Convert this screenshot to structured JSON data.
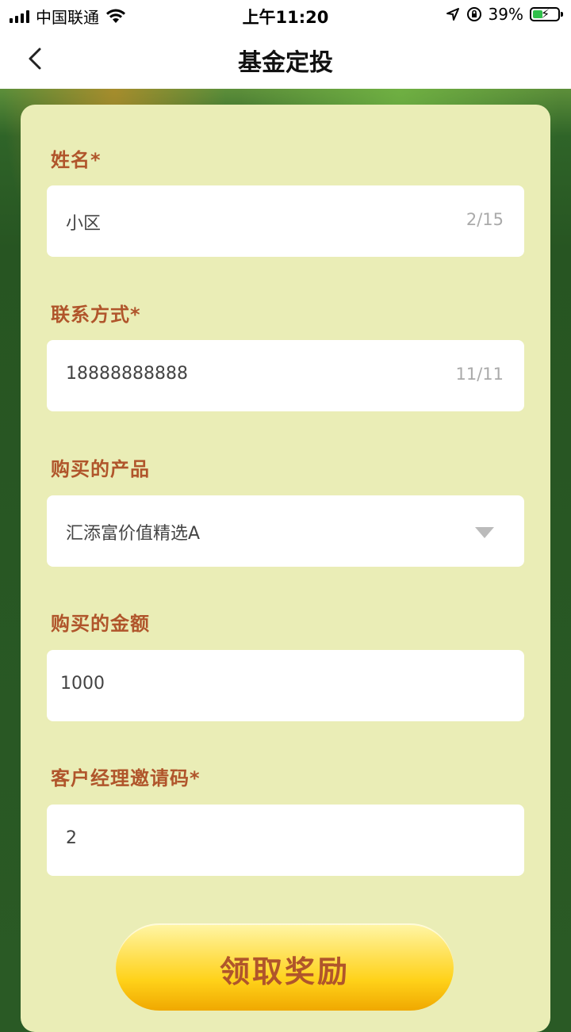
{
  "status_bar": {
    "carrier": "中国联通",
    "time": "上午11:20",
    "battery_percent": "39%"
  },
  "nav": {
    "title": "基金定投"
  },
  "form": {
    "name": {
      "label": "姓名*",
      "value": "小区",
      "counter": "2/15"
    },
    "contact": {
      "label": "联系方式*",
      "value": "18888888888",
      "counter": "11/11"
    },
    "product": {
      "label": "购买的产品",
      "value": "汇添富价值精选A"
    },
    "amount": {
      "label": "购买的金额",
      "value": "1000"
    },
    "invite_code": {
      "label": "客户经理邀请码*",
      "value": "2"
    }
  },
  "submit_label": "领取奖励",
  "colors": {
    "label": "#b0552b",
    "card": "#eaedb6",
    "button_top": "#fff6a8",
    "button_bottom": "#f0a800",
    "background": "#2a5a25"
  }
}
